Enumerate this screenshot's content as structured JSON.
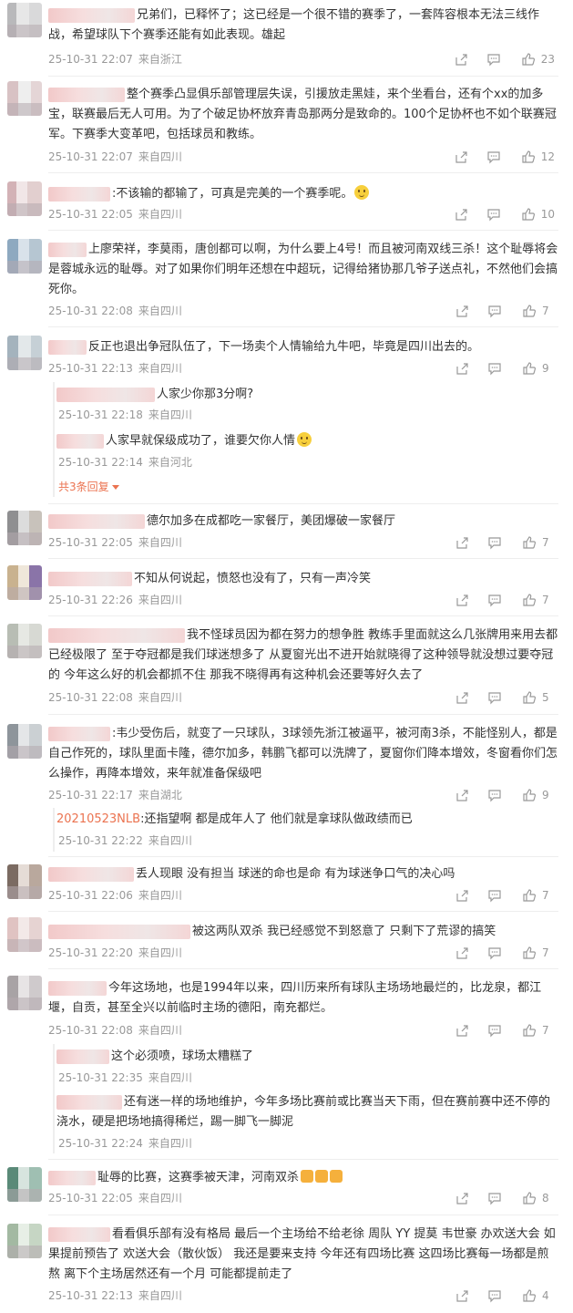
{
  "icons": {
    "share": "share-icon",
    "comment": "comment-icon",
    "like": "thumb-up-icon",
    "more": "chevron-down-icon",
    "emoji_smile": "smile-emoji-icon",
    "emoji_laugh": "laugh-cry-emoji-icon",
    "emoji_thumb_down": "thumb-down-emoji-icon"
  },
  "colors": {
    "text": "#333333",
    "meta": "#999999",
    "accent": "#eb7350"
  },
  "comments": [
    {
      "text": "兄弟们，已释怀了；这已经是一个很不错的赛季了，一套阵容根本无法三线作战，希望球队下个赛季还能有如此表现。雄起",
      "time": "25-10-31 22:07",
      "loc": "来自浙江",
      "likes": "23"
    },
    {
      "text": "整个赛季凸显俱乐部管理层失误，引援放走黑娃，来个坐看台，还有个xx的加多宝，联赛最后无人可用。为了个破足协杯放弃青岛那两分是致命的。100个足协杯也不如个联赛冠军。下赛季大变革吧，包括球员和教练。",
      "time": "25-10-31 22:07",
      "loc": "来自四川",
      "likes": "12"
    },
    {
      "text": ":不该输的都输了，可真是完美的一个赛季呢。",
      "time": "25-10-31 22:05",
      "loc": "来自四川",
      "likes": "10"
    },
    {
      "text": "上廖荣祥，李莫雨，唐创都可以啊，为什么要上4号！而且被河南双线三杀！这个耻辱将会是蓉城永远的耻辱。对了如果你们明年还想在中超玩，记得给猪协那几爷子送点礼，不然他们会搞死你。",
      "time": "25-10-31 22:08",
      "loc": "来自四川",
      "likes": "7"
    },
    {
      "text": "反正也退出争冠队伍了，下一场卖个人情输给九牛吧，毕竟是四川出去的。",
      "time": "25-10-31 22:13",
      "loc": "来自四川",
      "likes": "9",
      "replies": [
        {
          "text": "人家少你那3分啊?",
          "time": "25-10-31 22:18",
          "loc": "来自四川"
        },
        {
          "text": "人家早就保级成功了，谁要欠你人情",
          "time": "25-10-31 22:14",
          "loc": "来自河北"
        }
      ],
      "more": "共3条回复"
    },
    {
      "text": "德尔加多在成都吃一家餐厅，美团爆破一家餐厅",
      "time": "25-10-31 22:05",
      "loc": "来自四川",
      "likes": "7"
    },
    {
      "text": "不知从何说起，愤怒也没有了，只有一声冷笑",
      "time": "25-10-31 22:26",
      "loc": "来自四川",
      "likes": "7"
    },
    {
      "text": "我不怪球员因为都在努力的想争胜  教练手里面就这么几张牌用来用去都已经极限了  至于夺冠都是我们球迷想多了  从夏窗光出不进开始就晓得了这种领导就没想过要夺冠的  今年这么好的机会都抓不住  那我不晓得再有这种机会还要等好久去了",
      "time": "25-10-31 22:08",
      "loc": "来自四川",
      "likes": "5"
    },
    {
      "text": ":韦少受伤后，就变了一只球队，3球领先浙江被逼平，被河南3杀，不能怪别人，都是自己作死的，球队里面卡隆，德尔加多，韩鹏飞都可以洗牌了，夏窗你们降本增效，冬窗看你们怎么操作，再降本增效，来年就准备保级吧",
      "time": "25-10-31 22:17",
      "loc": "来自湖北",
      "likes": "9",
      "replies": [
        {
          "name": "20210523NLB",
          "text": ":还指望啊 都是成年人了 他们就是拿球队做政绩而已",
          "time": "25-10-31 22:22",
          "loc": "来自四川"
        }
      ]
    },
    {
      "text": "丢人现眼 没有担当 球迷的命也是命 有为球迷争口气的决心吗",
      "time": "25-10-31 22:06",
      "loc": "来自四川",
      "likes": "7"
    },
    {
      "text": "被这两队双杀 我已经感觉不到怒意了 只剩下了荒谬的搞笑",
      "time": "25-10-31 22:20",
      "loc": "来自四川",
      "likes": "7"
    },
    {
      "text": "今年这场地，也是1994年以来，四川历来所有球队主场场地最烂的，比龙泉，都江堰，自贡，甚至全兴以前临时主场的德阳，南充都烂。",
      "time": "25-10-31 22:08",
      "loc": "来自四川",
      "likes": "7",
      "replies": [
        {
          "text": "这个必须喷，球场太糟糕了",
          "time": "25-10-31 22:35",
          "loc": "来自四川"
        },
        {
          "text": "还有迷一样的场地维护，今年多场比赛前或比赛当天下雨，但在赛前赛中还不停的浇水，硬是把场地搞得稀烂，踢一脚飞一脚泥",
          "time": "25-10-31 22:24",
          "loc": "来自四川"
        }
      ]
    },
    {
      "text": "耻辱的比赛，这赛季被天津，河南双杀",
      "time": "25-10-31 22:05",
      "loc": "来自四川",
      "likes": "8"
    },
    {
      "text": "看看俱乐部有没有格局 最后一个主场给不给老徐 周队  YY 提莫 韦世豪 办欢送大会 如果提前预告了 欢送大会（散伙饭） 我还是要来支持 今年还有四场比赛 这四场比赛每一场都是煎熬 离下个主场居然还有一个月 可能都提前走了",
      "time": "25-10-31 22:13",
      "loc": "来自四川",
      "likes": "4"
    }
  ]
}
